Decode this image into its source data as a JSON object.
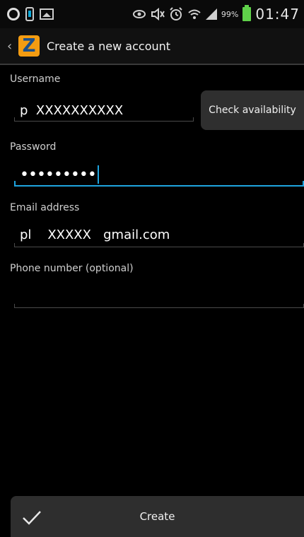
{
  "status_bar": {
    "battery_percent": "99%",
    "time": "01:47"
  },
  "action_bar": {
    "title": "Create a new account",
    "logo_letter": "Z",
    "back_glyph": "‹"
  },
  "form": {
    "username": {
      "label": "Username",
      "value": "p  XXXXXXXXXX"
    },
    "check_availability_label": "Check availability",
    "password": {
      "label": "Password",
      "masked_value": "•••••••••"
    },
    "email": {
      "label": "Email address",
      "value": "pl    XXXXX   gmail.com"
    },
    "phone": {
      "label": "Phone number (optional)",
      "value": ""
    }
  },
  "footer": {
    "create_label": "Create"
  },
  "icons": {
    "status_left": [
      "circle-notification-icon",
      "phone-icon",
      "image-icon"
    ],
    "status_right": [
      "eye-icon",
      "mute-icon",
      "alarm-icon",
      "wifi-icon",
      "signal-icon",
      "battery-icon"
    ],
    "create": "checkmark-icon"
  },
  "colors": {
    "accent": "#1ea4de",
    "logo": "#f39c12",
    "battery": "#5fd14a"
  }
}
